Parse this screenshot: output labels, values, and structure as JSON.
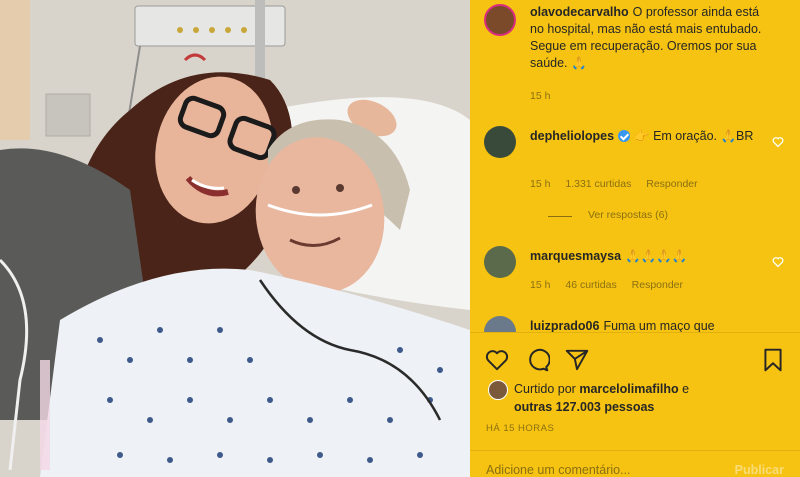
{
  "post": {
    "caption_user": "olavodecarvalho",
    "caption_text": "O professor ainda está no hospital, mas não está mais entubado. Segue em recuperação. Oremos por sua saúde. 🙏",
    "caption_time": "15 h"
  },
  "comments": [
    {
      "user": "depheliolopes",
      "text": "👉 Em oração. 🙏BR",
      "time": "15 h",
      "likes": "1.331 curtidas",
      "reply": "Responder",
      "view_replies": "Ver respostas (6)"
    },
    {
      "user": "marquesmaysa",
      "text": "🙏🙏🙏🙏",
      "time": "15 h",
      "likes": "46 curtidas",
      "reply": "Responder"
    },
    {
      "user": "luizprado06",
      "text": "Fuma um maço que"
    }
  ],
  "likes": {
    "prefix": "Curtido por",
    "user": "marcelolimafilho",
    "conj": "e",
    "others": "outras 127.003 pessoas"
  },
  "timestamp": "HÁ 15 HORAS",
  "comment_box": {
    "placeholder": "Adicione um comentário...",
    "publish": "Publicar"
  },
  "colors": {
    "panel": "#f6c312",
    "text": "#262626",
    "muted": "#8a6f12",
    "verified": "#3897f0"
  },
  "icons": [
    "heart-icon",
    "comment-icon",
    "share-icon",
    "save-icon"
  ]
}
